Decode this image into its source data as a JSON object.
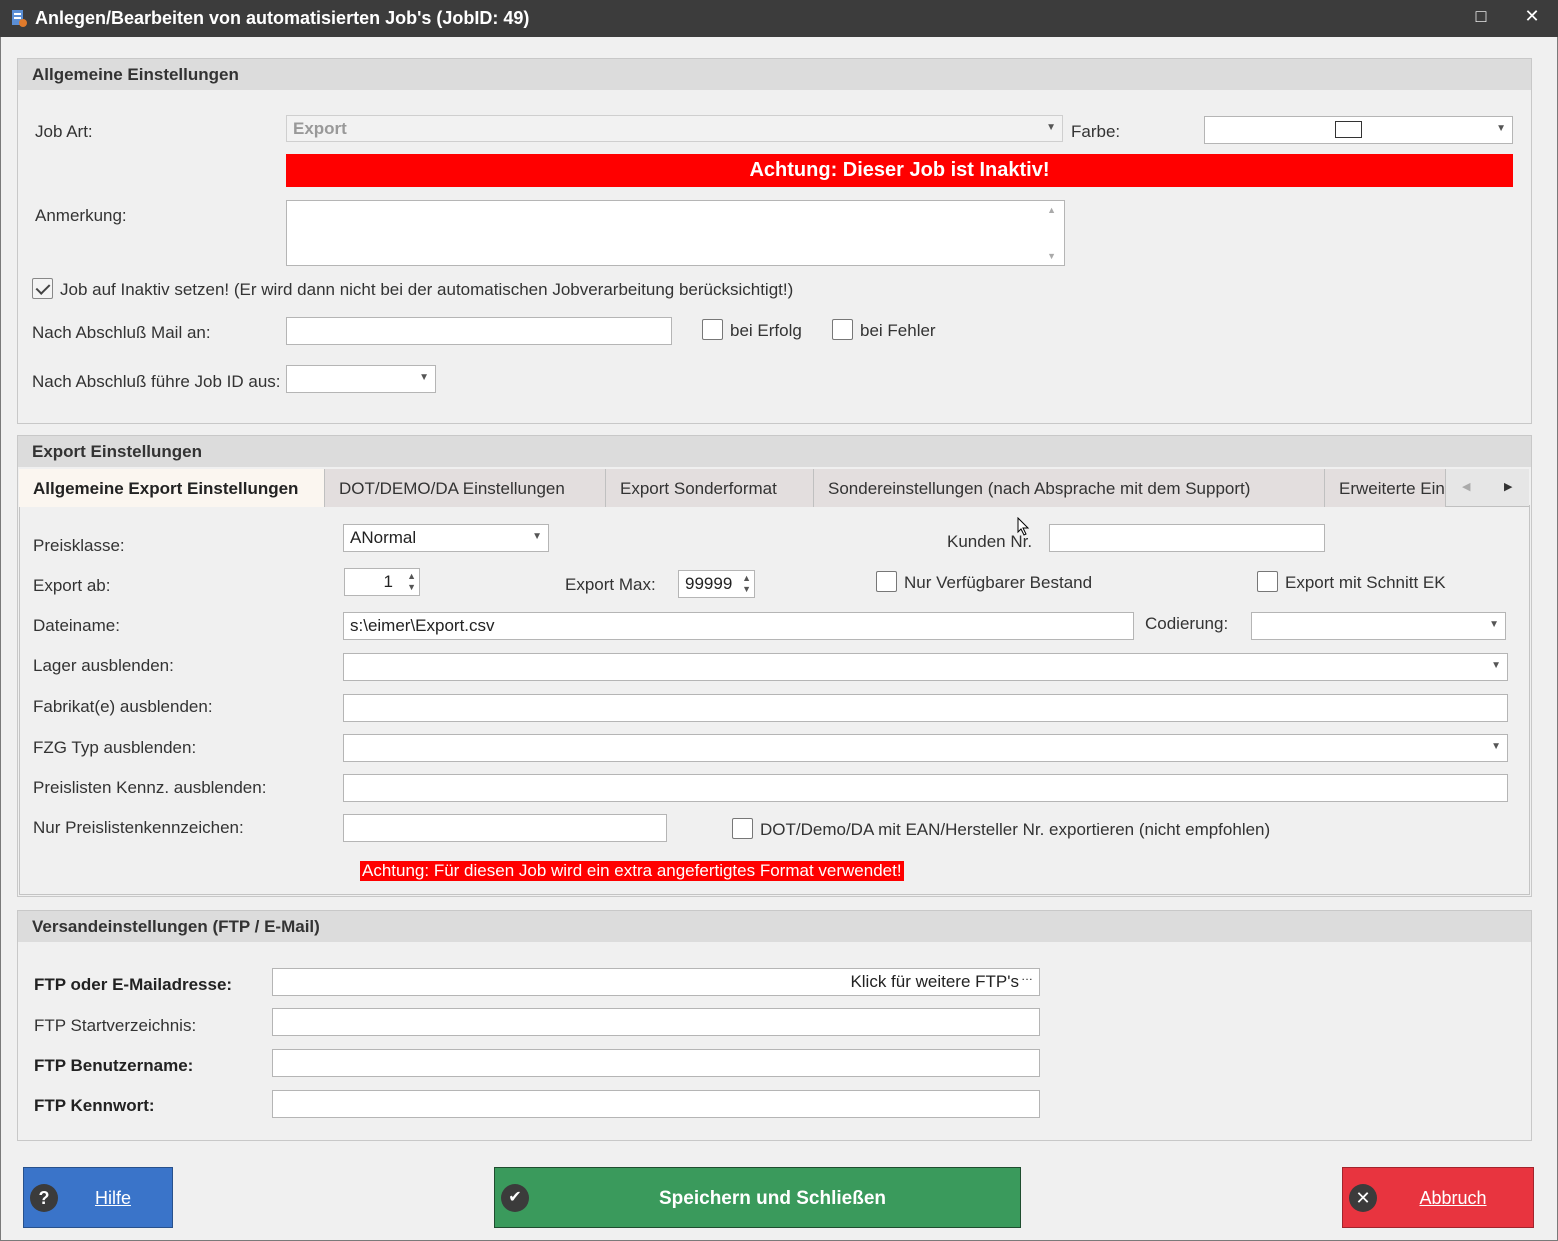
{
  "window": {
    "title": "Anlegen/Bearbeiten von automatisierten Job's (JobID: 49)",
    "maximize_glyph": "□",
    "close_glyph": "✕"
  },
  "general": {
    "header": "Allgemeine Einstellungen",
    "job_art_label": "Job Art:",
    "job_art_value": "Export",
    "farbe_label": "Farbe:",
    "inactive_warning": "Achtung: Dieser Job ist Inaktiv!",
    "anmerkung_label": "Anmerkung:",
    "anmerkung_value": "",
    "inactive_checkbox_label": "Job auf Inaktiv setzen! (Er wird dann nicht bei der automatischen Jobverarbeitung berücksichtigt!)",
    "inactive_checked": true,
    "mail_label": "Nach Abschluß Mail an:",
    "mail_value": "",
    "bei_erfolg_label": "bei Erfolg",
    "bei_fehler_label": "bei Fehler",
    "next_job_label": "Nach Abschluß führe Job ID aus:",
    "next_job_value": ""
  },
  "export": {
    "header": "Export Einstellungen",
    "tabs": [
      "Allgemeine Export Einstellungen",
      "DOT/DEMO/DA Einstellungen",
      "Export Sonderformat",
      "Sondereinstellungen (nach Absprache mit dem Support)",
      "Erweiterte Ein"
    ],
    "preisklasse_label": "Preisklasse:",
    "preisklasse_value": "ANormal",
    "kunden_nr_label": "Kunden Nr.",
    "kunden_nr_value": "",
    "export_ab_label": "Export ab:",
    "export_ab_value": "1",
    "export_max_label": "Export Max:",
    "export_max_value": "99999",
    "nur_verfuegbar_label": "Nur Verfügbarer Bestand",
    "schnitt_ek_label": "Export mit Schnitt EK",
    "dateiname_label": "Dateiname:",
    "dateiname_value": "s:\\eimer\\Export.csv",
    "codierung_label": "Codierung:",
    "codierung_value": "",
    "lager_label": "Lager ausblenden:",
    "fabrikat_label": "Fabrikat(e) ausblenden:",
    "fzg_label": "FZG Typ  ausblenden:",
    "preislisten_label": "Preislisten Kennz. ausblenden:",
    "nur_preisliste_label": "Nur Preislistenkennzeichen:",
    "ean_label": "DOT/Demo/DA mit EAN/Hersteller Nr. exportieren (nicht empfohlen)",
    "format_warning": "Achtung: Für diesen Job wird ein extra angefertigtes Format verwendet!"
  },
  "shipping": {
    "header": "Versandeinstellungen (FTP / E-Mail)",
    "ftp_label": "FTP oder E-Mailadresse:",
    "ftp_button": "Klick für weitere FTP's",
    "start_label": "FTP Startverzeichnis:",
    "user_label": "FTP Benutzername:",
    "pass_label": "FTP Kennwort:"
  },
  "footer": {
    "help": "Hilfe",
    "save": "Speichern und Schließen",
    "cancel": "Abbruch"
  },
  "colors": {
    "help_button": "#3a74c9",
    "save_button": "#3a9a5c",
    "cancel_button": "#e8343f",
    "warning_red": "#ff0000"
  }
}
